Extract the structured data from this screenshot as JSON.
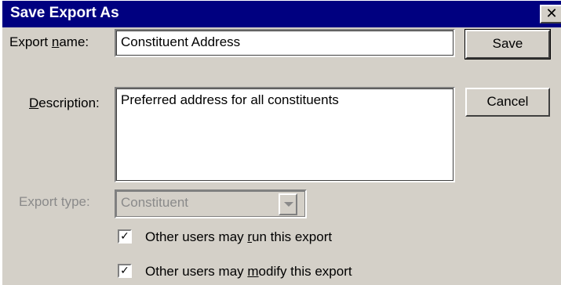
{
  "dialog": {
    "title": "Save Export As",
    "close_glyph": "✕"
  },
  "form": {
    "name_label_pre": "Export ",
    "name_label_key": "n",
    "name_label_post": "ame:",
    "name_value": "Constituent Address",
    "description_label_key": "D",
    "description_label_post": "escription:",
    "description_value": "Preferred address for all constituents",
    "type_label": "Export type:",
    "type_value": "Constituent",
    "type_enabled": false
  },
  "checkboxes": [
    {
      "pre": "Other users may ",
      "key": "r",
      "post": "un this export",
      "checked": true
    },
    {
      "pre": "Other users may ",
      "key": "m",
      "post": "odify this export",
      "checked": true
    }
  ],
  "buttons": {
    "save": "Save",
    "cancel": "Cancel"
  },
  "icons": {
    "check": "✓",
    "dropdown": "chevron-down-icon",
    "close": "close-icon"
  }
}
